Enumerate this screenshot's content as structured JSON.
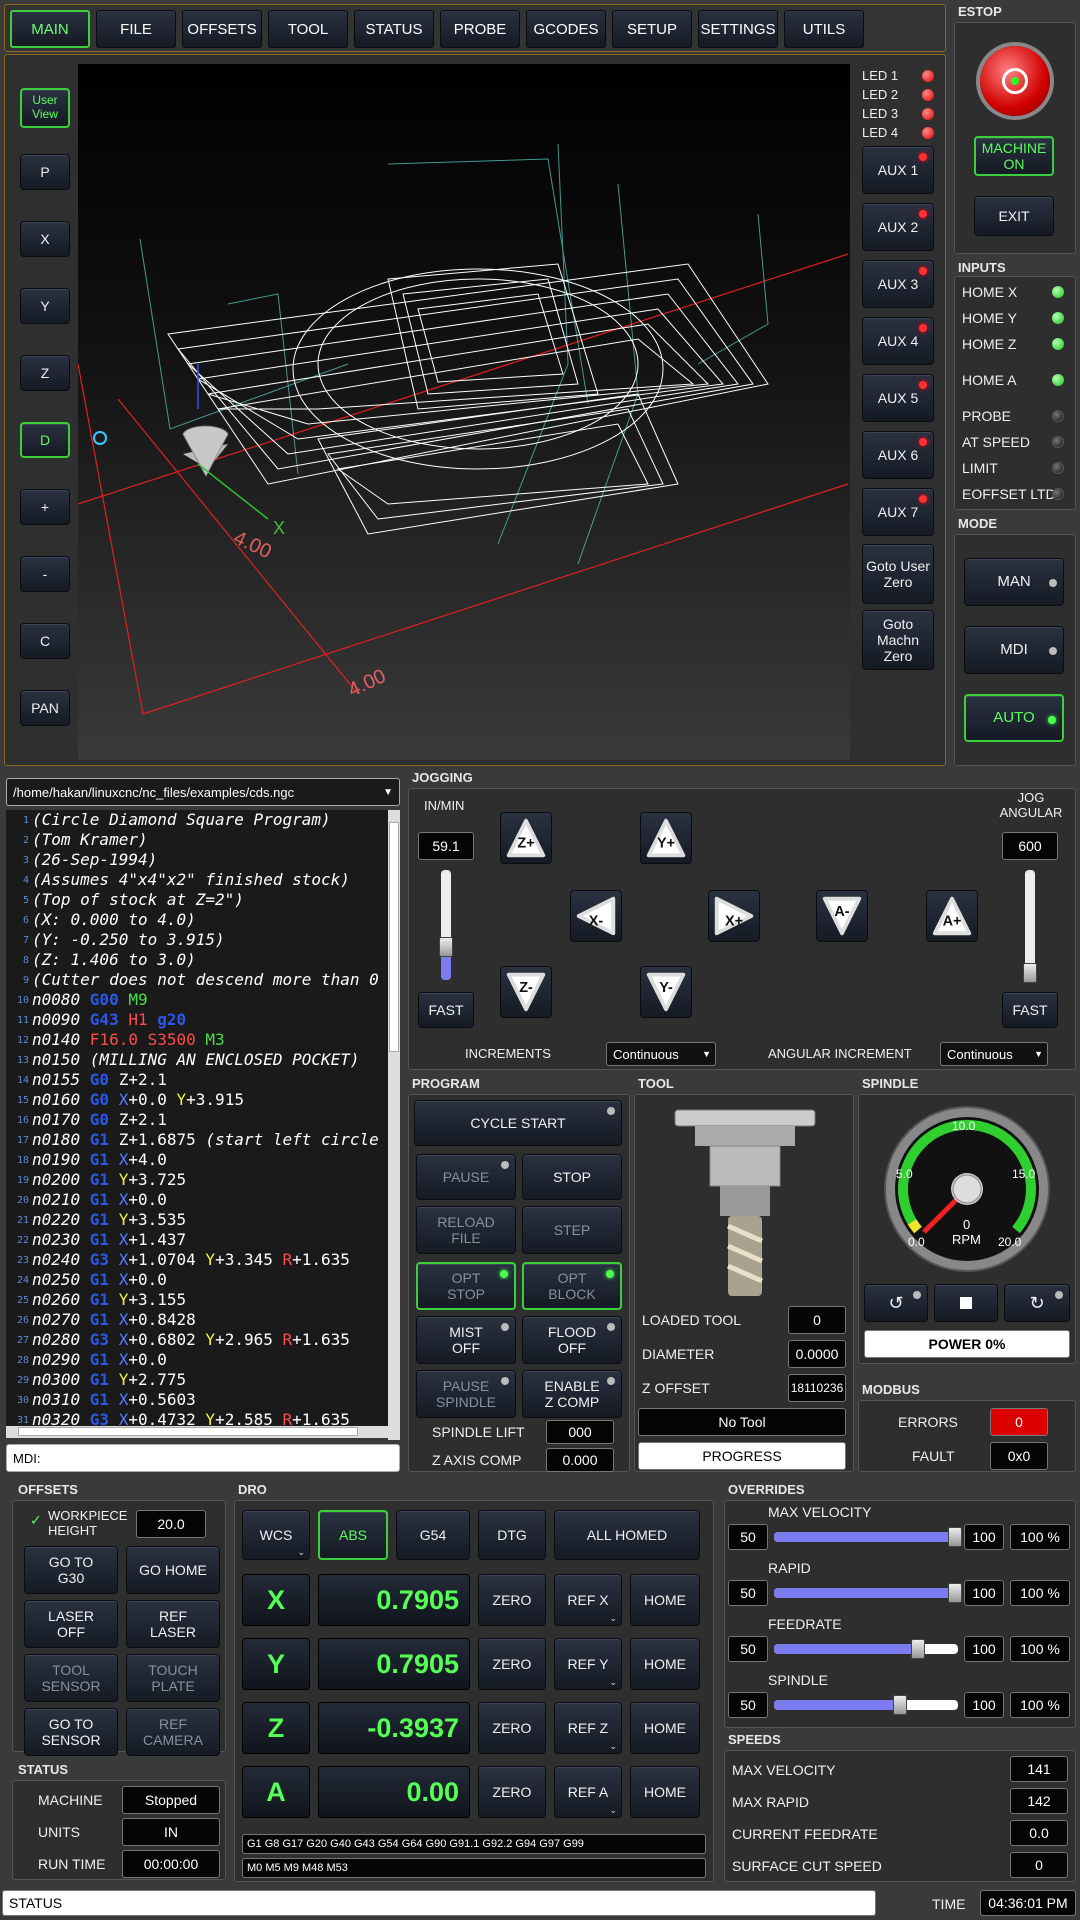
{
  "tabs": [
    "MAIN",
    "FILE",
    "OFFSETS",
    "TOOL",
    "STATUS",
    "PROBE",
    "GCODES",
    "SETUP",
    "SETTINGS",
    "UTILS"
  ],
  "view_buttons": [
    "User View",
    "P",
    "X",
    "Y",
    "Z",
    "D",
    "+",
    "-",
    "C",
    "PAN"
  ],
  "leds": [
    "LED 1",
    "LED 2",
    "LED 3",
    "LED 4"
  ],
  "aux_buttons": [
    "AUX 1",
    "AUX 2",
    "AUX 3",
    "AUX 4",
    "AUX 5",
    "AUX 6",
    "AUX 7"
  ],
  "goto_user_zero": "Goto User Zero",
  "goto_machn_zero": "Goto Machn Zero",
  "preview_labels": {
    "x_dim": "4.00",
    "y_dim": "4.00",
    "axis_x": "X"
  },
  "estop": {
    "title": "ESTOP",
    "machine_on": "MACHINE ON",
    "exit": "EXIT"
  },
  "inputs": {
    "title": "INPUTS",
    "items": [
      {
        "label": "HOME X",
        "state": "on"
      },
      {
        "label": "HOME Y",
        "state": "on"
      },
      {
        "label": "HOME Z",
        "state": "on"
      },
      {
        "label": "HOME A",
        "state": "on"
      },
      {
        "label": "PROBE",
        "state": "off"
      },
      {
        "label": "AT SPEED",
        "state": "off"
      },
      {
        "label": "LIMIT",
        "state": "off"
      },
      {
        "label": "EOFFSET LTD",
        "state": "off"
      }
    ]
  },
  "mode": {
    "title": "MODE",
    "items": [
      "MAN",
      "MDI",
      "AUTO"
    ],
    "active": "AUTO"
  },
  "file_path": "/home/hakan/linuxcnc/nc_files/examples/cds.ngc",
  "mdi_label": "MDI:",
  "jogging": {
    "title": "JOGGING",
    "in_min": "IN/MIN",
    "linear_rate": "59.1",
    "jog_angular": "JOG ANGULAR",
    "angular_rate": "600",
    "fast": "FAST",
    "increments_label": "INCREMENTS",
    "increments_value": "Continuous",
    "angular_increment_label": "ANGULAR INCREMENT",
    "angular_increment_value": "Continuous",
    "linear_slider_fraction": 0.3,
    "angular_slider_fraction": 0.06,
    "buttons": [
      "Z+",
      "Y+",
      "X-",
      "X+",
      "A-",
      "A+",
      "Z-",
      "Y-"
    ]
  },
  "program": {
    "title": "PROGRAM",
    "cycle_start": "CYCLE START",
    "pause": "PAUSE",
    "stop": "STOP",
    "reload_file": "RELOAD FILE",
    "step": "STEP",
    "opt_stop": "OPT STOP",
    "opt_block": "OPT BLOCK",
    "mist_off": "MIST OFF",
    "flood_off": "FLOOD OFF",
    "pause_spindle": "PAUSE SPINDLE",
    "enable_z_comp": "ENABLE Z COMP",
    "spindle_lift_label": "SPINDLE LIFT",
    "spindle_lift_value": "000",
    "z_axis_comp_label": "Z AXIS COMP",
    "z_axis_comp_value": "0.000"
  },
  "tool": {
    "title": "TOOL",
    "loaded_tool_label": "LOADED TOOL",
    "loaded_tool_value": "0",
    "diameter_label": "DIAMETER",
    "diameter_value": "0.0000",
    "z_offset_label": "Z OFFSET",
    "z_offset_value": "18110236",
    "tool_name": "No Tool",
    "progress": "PROGRESS"
  },
  "spindle": {
    "title": "SPINDLE",
    "rpm": "0",
    "rpm_label": "RPM",
    "scale": [
      "0.0",
      "5.0",
      "10.0",
      "15.0",
      "20.0"
    ],
    "power": "POWER 0%"
  },
  "modbus": {
    "title": "MODBUS",
    "errors_label": "ERRORS",
    "errors_value": "0",
    "fault_label": "FAULT",
    "fault_value": "0x0"
  },
  "offsets": {
    "title": "OFFSETS",
    "workpiece_height_label": "WORKPIECE HEIGHT",
    "workpiece_height_value": "20.0",
    "buttons": [
      "GO TO G30",
      "GO HOME",
      "LASER OFF",
      "REF LASER",
      "TOOL SENSOR",
      "TOUCH PLATE",
      "GO TO SENSOR",
      "REF CAMERA"
    ]
  },
  "status": {
    "title": "STATUS",
    "machine_label": "MACHINE",
    "machine_value": "Stopped",
    "units_label": "UNITS",
    "units_value": "IN",
    "run_time_label": "RUN TIME",
    "run_time_value": "00:00:00"
  },
  "dro": {
    "title": "DRO",
    "wcs": "WCS",
    "abs": "ABS",
    "g54": "G54",
    "dtg": "DTG",
    "all_homed": "ALL HOMED",
    "zero": "ZERO",
    "home": "HOME",
    "axes": [
      {
        "axis": "X",
        "value": "0.7905",
        "ref": "REF X"
      },
      {
        "axis": "Y",
        "value": "0.7905",
        "ref": "REF Y"
      },
      {
        "axis": "Z",
        "value": "-0.3937",
        "ref": "REF Z"
      },
      {
        "axis": "A",
        "value": "0.00",
        "ref": "REF A"
      }
    ],
    "gcodes": "G1 G8 G17 G20 G40 G43 G54 G64 G90 G91.1 G92.2 G94 G97 G99",
    "mcodes": "M0 M5 M9 M48 M53"
  },
  "overrides": {
    "title": "OVERRIDES",
    "items": [
      {
        "label": "MAX VELOCITY",
        "min": "50",
        "max": "100",
        "pct": "100 %",
        "fraction": 1.0
      },
      {
        "label": "RAPID",
        "min": "50",
        "max": "100",
        "pct": "100 %",
        "fraction": 1.0
      },
      {
        "label": "FEEDRATE",
        "min": "50",
        "max": "100",
        "pct": "100 %",
        "fraction": 0.8
      },
      {
        "label": "SPINDLE",
        "min": "50",
        "max": "100",
        "pct": "100 %",
        "fraction": 0.7
      }
    ]
  },
  "speeds": {
    "title": "SPEEDS",
    "items": [
      {
        "label": "MAX VELOCITY",
        "value": "141"
      },
      {
        "label": "MAX RAPID",
        "value": "142"
      },
      {
        "label": "CURRENT FEEDRATE",
        "value": "0.0"
      },
      {
        "label": "SURFACE CUT SPEED",
        "value": "0"
      }
    ]
  },
  "statusbar": {
    "label": "STATUS",
    "time_label": "TIME",
    "time_value": "04:36:01 PM"
  },
  "colors": {
    "accent_green": "#3ccf3c",
    "led_red": "#e00000",
    "dro_green": "#56ff56"
  }
}
